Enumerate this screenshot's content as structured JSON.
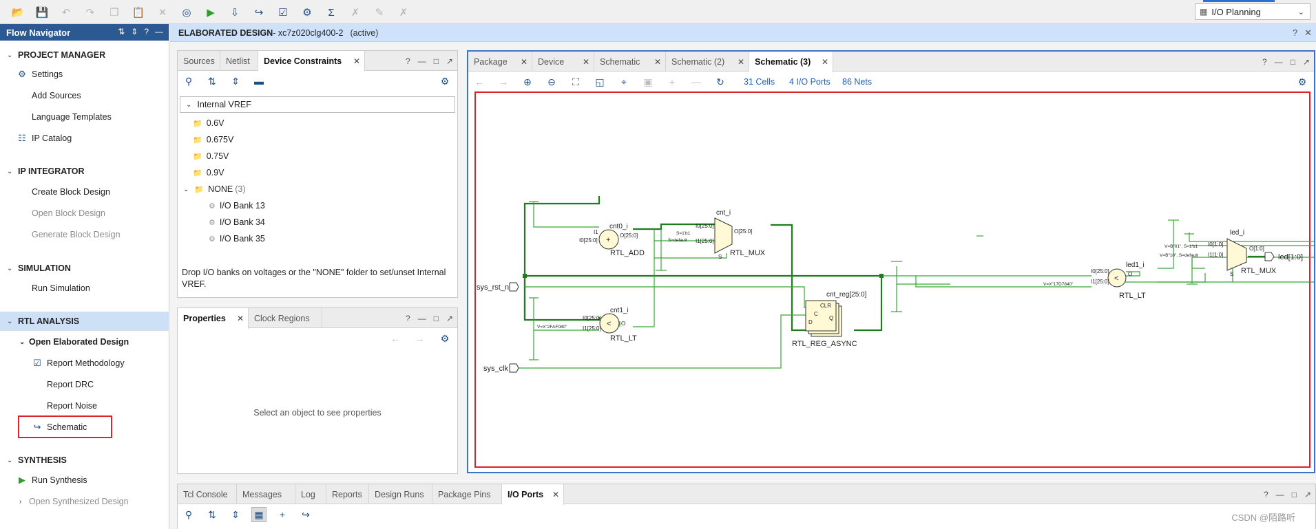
{
  "toolbar": {
    "layout": "I/O Planning",
    "icons": [
      "open-project-icon",
      "save-icon",
      "undo-icon",
      "redo-icon",
      "copy-icon",
      "paste-icon",
      "delete-icon",
      "binoculars-icon",
      "run-icon",
      "program-icon",
      "schematic-icon",
      "report-icon",
      "settings-icon",
      "sigma-icon",
      "tool-a-icon",
      "tool-b-icon",
      "tool-c-icon"
    ]
  },
  "flow_nav": {
    "title": "Flow Navigator",
    "sections": {
      "project_manager": "PROJECT MANAGER",
      "ip_integrator": "IP INTEGRATOR",
      "simulation": "SIMULATION",
      "rtl_analysis": "RTL ANALYSIS",
      "synthesis": "SYNTHESIS"
    },
    "items": {
      "settings": "Settings",
      "add_sources": "Add Sources",
      "language_templates": "Language Templates",
      "ip_catalog": "IP Catalog",
      "create_block_design": "Create Block Design",
      "open_block_design": "Open Block Design",
      "generate_block_design": "Generate Block Design",
      "run_simulation": "Run Simulation",
      "open_elaborated_design": "Open Elaborated Design",
      "report_methodology": "Report Methodology",
      "report_drc": "Report DRC",
      "report_noise": "Report Noise",
      "schematic": "Schematic",
      "run_synthesis": "Run Synthesis",
      "open_synthesized_design": "Open Synthesized Design"
    }
  },
  "design_bar": {
    "title": "ELABORATED DESIGN",
    "part": " - xc7z020clg400-2",
    "status": "(active)"
  },
  "sources_panel": {
    "tabs": [
      "Sources",
      "Netlist",
      "Device Constraints"
    ],
    "tree_root": "Internal VREF",
    "voltages": [
      "0.6V",
      "0.675V",
      "0.75V",
      "0.9V"
    ],
    "none_label": "NONE",
    "none_count": "(3)",
    "banks": [
      "I/O Bank 13",
      "I/O Bank 34",
      "I/O Bank 35"
    ],
    "hint": "Drop I/O banks on voltages or the \"NONE\" folder to set/unset Internal VREF."
  },
  "properties_panel": {
    "tabs": [
      "Properties",
      "Clock Regions"
    ],
    "empty_text": "Select an object to see properties"
  },
  "schematic_panel": {
    "tabs": [
      "Package",
      "Device",
      "Schematic",
      "Schematic (2)",
      "Schematic (3)"
    ],
    "cells": "31 Cells",
    "ports": "4 I/O Ports",
    "nets": "86 Nets"
  },
  "schematic": {
    "ports": {
      "sys_rst_n": "sys_rst_n",
      "sys_clk": "sys_clk",
      "led": "led[1:0]"
    },
    "cnt0": {
      "name": "cnt0_i",
      "type": "RTL_ADD",
      "i1": "I1",
      "i0": "I0[25:0]",
      "o": "O[25:0]",
      "sym": "+"
    },
    "cnt_mux": {
      "name": "cnt_i",
      "type": "RTL_MUX",
      "i0": "I0[25:0]",
      "i1": "I1[25:0]",
      "o": "O[25:0]",
      "s": "S",
      "s_eq": "S=1'b1",
      "s_def": "S=default"
    },
    "cnt1": {
      "name": "cnt1_i",
      "type": "RTL_LT",
      "i0": "I0[25:0]",
      "i1": "I1[25:0]",
      "o": "O",
      "sym": "<",
      "const": "V=X\"2FAF080\""
    },
    "cnt_reg": {
      "name": "cnt_reg[25:0]",
      "type": "RTL_REG_ASYNC",
      "clr": "CLR",
      "c": "C",
      "d": "D",
      "q": "Q"
    },
    "led1": {
      "name": "led1_i",
      "type": "RTL_LT",
      "i0": "I0[25:0]",
      "i1": "I1[25:0]",
      "o": "O",
      "sym": "<",
      "const": "V=X\"17D7840\""
    },
    "led_mux": {
      "name": "led_i",
      "type": "RTL_MUX",
      "i0": "I0[1:0]",
      "i1": "I1[1:0]",
      "o": "O[1:0]",
      "s": "S",
      "c0": "V=B\"01\", S=1'b1",
      "c1": "V=B\"10\", S=default"
    }
  },
  "bottom_panel": {
    "tabs": [
      "Tcl Console",
      "Messages",
      "Log",
      "Reports",
      "Design Runs",
      "Package Pins",
      "I/O Ports"
    ]
  },
  "watermark": "CSDN @陌路听"
}
